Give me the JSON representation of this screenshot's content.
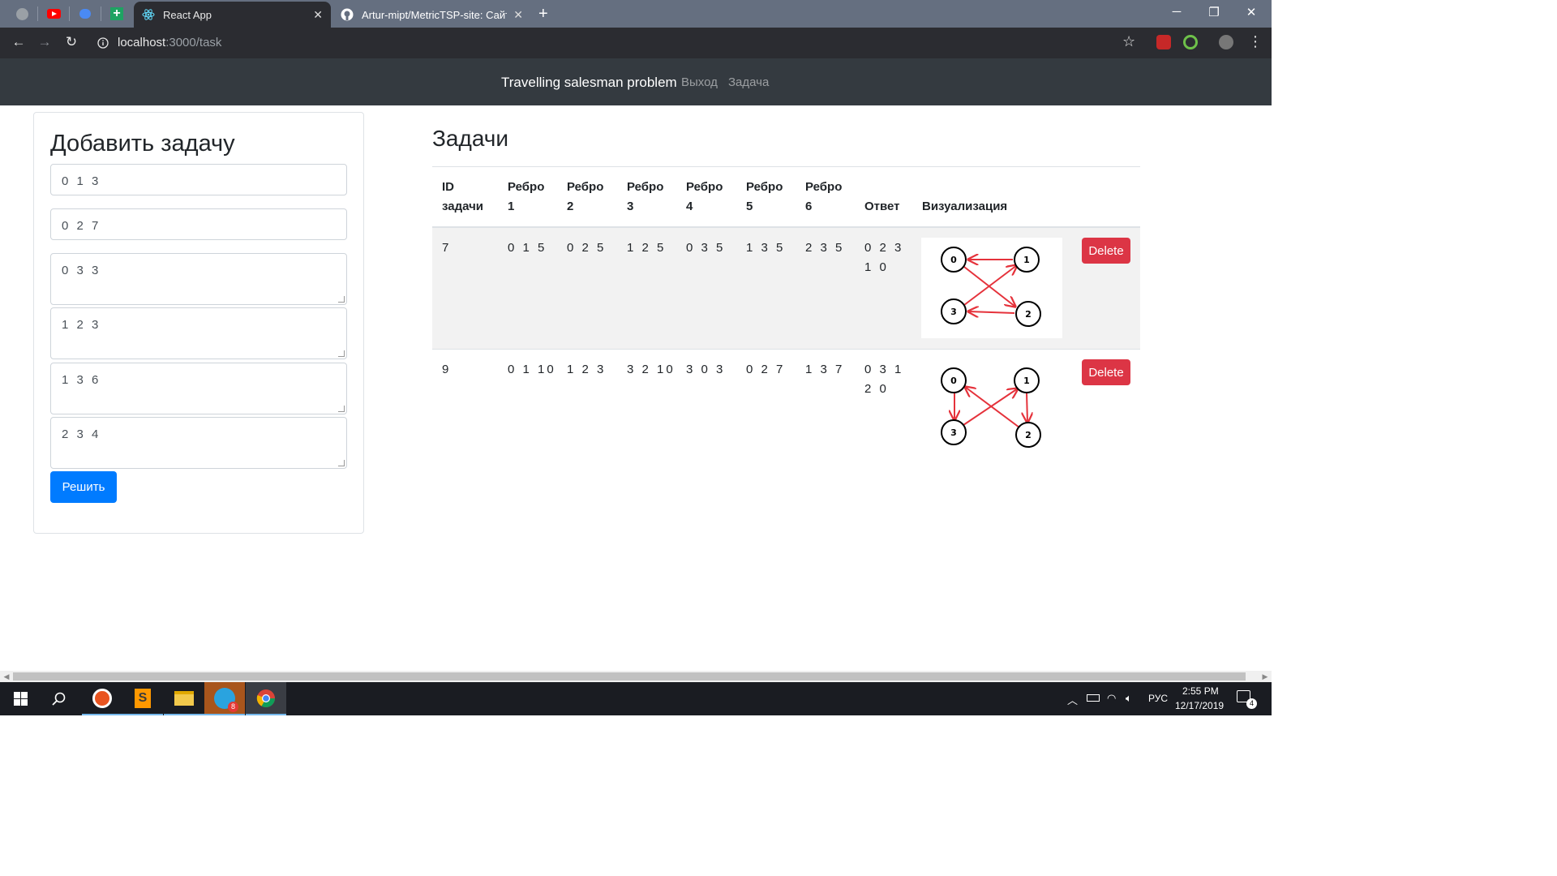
{
  "browser": {
    "tabs": [
      {
        "title": "React App",
        "active": true
      },
      {
        "title": "Artur-mipt/MetricTSP-site: Сайт ",
        "active": false
      }
    ],
    "url_host": "localhost",
    "url_path": ":3000/task"
  },
  "navbar": {
    "brand": "Travelling salesman problem",
    "links": [
      "Выход",
      "Задача"
    ]
  },
  "add_task": {
    "title": "Добавить задачу",
    "fields": [
      "0 1 3",
      "0 2 7",
      "0 3 3",
      "1 2 3",
      "1 3 6",
      "2 3 4"
    ],
    "submit_label": "Решить"
  },
  "tasks": {
    "title": "Задачи",
    "headers": {
      "id_line1": "ID",
      "id_line2": "задачи",
      "e1_line1": "Ребро",
      "e1_line2": "1",
      "e2_line1": "Ребро",
      "e2_line2": "2",
      "e3_line1": "Ребро",
      "e3_line2": "3",
      "e4_line1": "Ребро",
      "e4_line2": "4",
      "e5_line1": "Ребро",
      "e5_line2": "5",
      "e6_line1": "Ребро",
      "e6_line2": "6",
      "answer": "Ответ",
      "visualization": "Визуализация"
    },
    "rows": [
      {
        "id": "7",
        "edges": [
          "0 1 5",
          "0 2 5",
          "1 2 5",
          "0 3 5",
          "1 3 5",
          "2 3 5"
        ],
        "answer_line1": "0 2 3",
        "answer_line2": "1 0",
        "graph_nodes": [
          "0",
          "1",
          "2",
          "3"
        ],
        "delete_label": "Delete"
      },
      {
        "id": "9",
        "edges": [
          "0 1 10",
          "1 2 3",
          "3 2 10",
          "3 0 3",
          "0 2 7",
          "1 3 7"
        ],
        "answer_line1": "0 3 1",
        "answer_line2": "2 0",
        "graph_nodes": [
          "0",
          "1",
          "2",
          "3"
        ],
        "delete_label": "Delete"
      }
    ]
  },
  "taskbar": {
    "lang": "РУС",
    "time": "2:55 PM",
    "date": "12/17/2019",
    "notification_count": "4",
    "telegram_badge": "8"
  },
  "colors": {
    "primary": "#007bff",
    "danger": "#dc3545",
    "navbar": "#343a40",
    "arrow": "#e5323b"
  }
}
